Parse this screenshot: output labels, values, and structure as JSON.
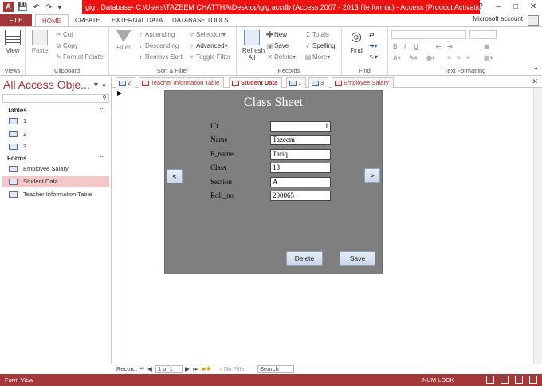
{
  "app": {
    "title": "gig : Database- C:\\Users\\TAZEEM CHATTHA\\Desktop\\gig.accdb (Access 2007 - 2013 file format) -  Access (Product Activation Failed)",
    "icon_letter": "A",
    "accent": "#a4373a",
    "title_bar_color": "#ee1111",
    "window_controls": [
      "?",
      "–",
      "□",
      "✕"
    ]
  },
  "ribbon_tabs": [
    "FILE",
    "HOME",
    "CREATE",
    "EXTERNAL DATA",
    "DATABASE TOOLS"
  ],
  "account": "Microsoft account",
  "ribbon": {
    "views": {
      "label": "Views",
      "view_button": "View"
    },
    "clipboard": {
      "label": "Clipboard",
      "paste": "Paste",
      "cut": "Cut",
      "copy": "Copy",
      "format_painter": "Format Painter"
    },
    "sort_filter": {
      "label": "Sort & Filter",
      "filter": "Filter",
      "ascending": "Ascending",
      "descending": "Descending",
      "remove_sort": "Remove Sort",
      "selection": "Selection",
      "advanced": "Advanced",
      "toggle_filter": "Toggle Filter"
    },
    "records": {
      "label": "Records",
      "refresh_all": "Refresh All",
      "new": "New",
      "save": "Save",
      "delete": "Delete",
      "totals": "Totals",
      "spelling": "Spelling",
      "more": "More"
    },
    "find": {
      "label": "Find",
      "find": "Find"
    },
    "text_formatting": {
      "label": "Text Formatting",
      "bold": "B",
      "italic": "I",
      "underline": "U"
    }
  },
  "nav": {
    "title": "All Access Obje...",
    "search_icon": "search-icon",
    "sections": [
      {
        "name": "Tables",
        "items": [
          "1",
          "2",
          "3"
        ]
      },
      {
        "name": "Forms",
        "items": [
          "Employee Salary",
          "Student Data",
          "Teacher Information Table"
        ]
      }
    ],
    "selected_item": "Student Data"
  },
  "doc_tabs": [
    {
      "label": "2",
      "kind": "table",
      "active": false
    },
    {
      "label": "Teacher Information Table",
      "kind": "form",
      "active": false
    },
    {
      "label": "Student Data",
      "kind": "form",
      "active": true
    },
    {
      "label": "1",
      "kind": "table",
      "active": false
    },
    {
      "label": "3",
      "kind": "table",
      "active": false
    },
    {
      "label": "Employee Salary",
      "kind": "form",
      "active": false
    }
  ],
  "form": {
    "title": "Class Sheet",
    "fields": [
      {
        "label": "ID",
        "value": "1"
      },
      {
        "label": "Name",
        "value": "Tazeem"
      },
      {
        "label": "F_name",
        "value": "Tariq"
      },
      {
        "label": "Class",
        "value": "13"
      },
      {
        "label": "Section",
        "value": "A"
      },
      {
        "label": "Roll_no",
        "value": "200065"
      }
    ],
    "prev_button": "<",
    "next_button": ">",
    "delete_button": "Delete",
    "save_button": "Save"
  },
  "record_nav": {
    "label": "Record:",
    "position": "1 of 1",
    "filter_status": "No Filter",
    "search": "Search"
  },
  "status": {
    "view": "Form View",
    "numlock": "NUM LOCK"
  }
}
